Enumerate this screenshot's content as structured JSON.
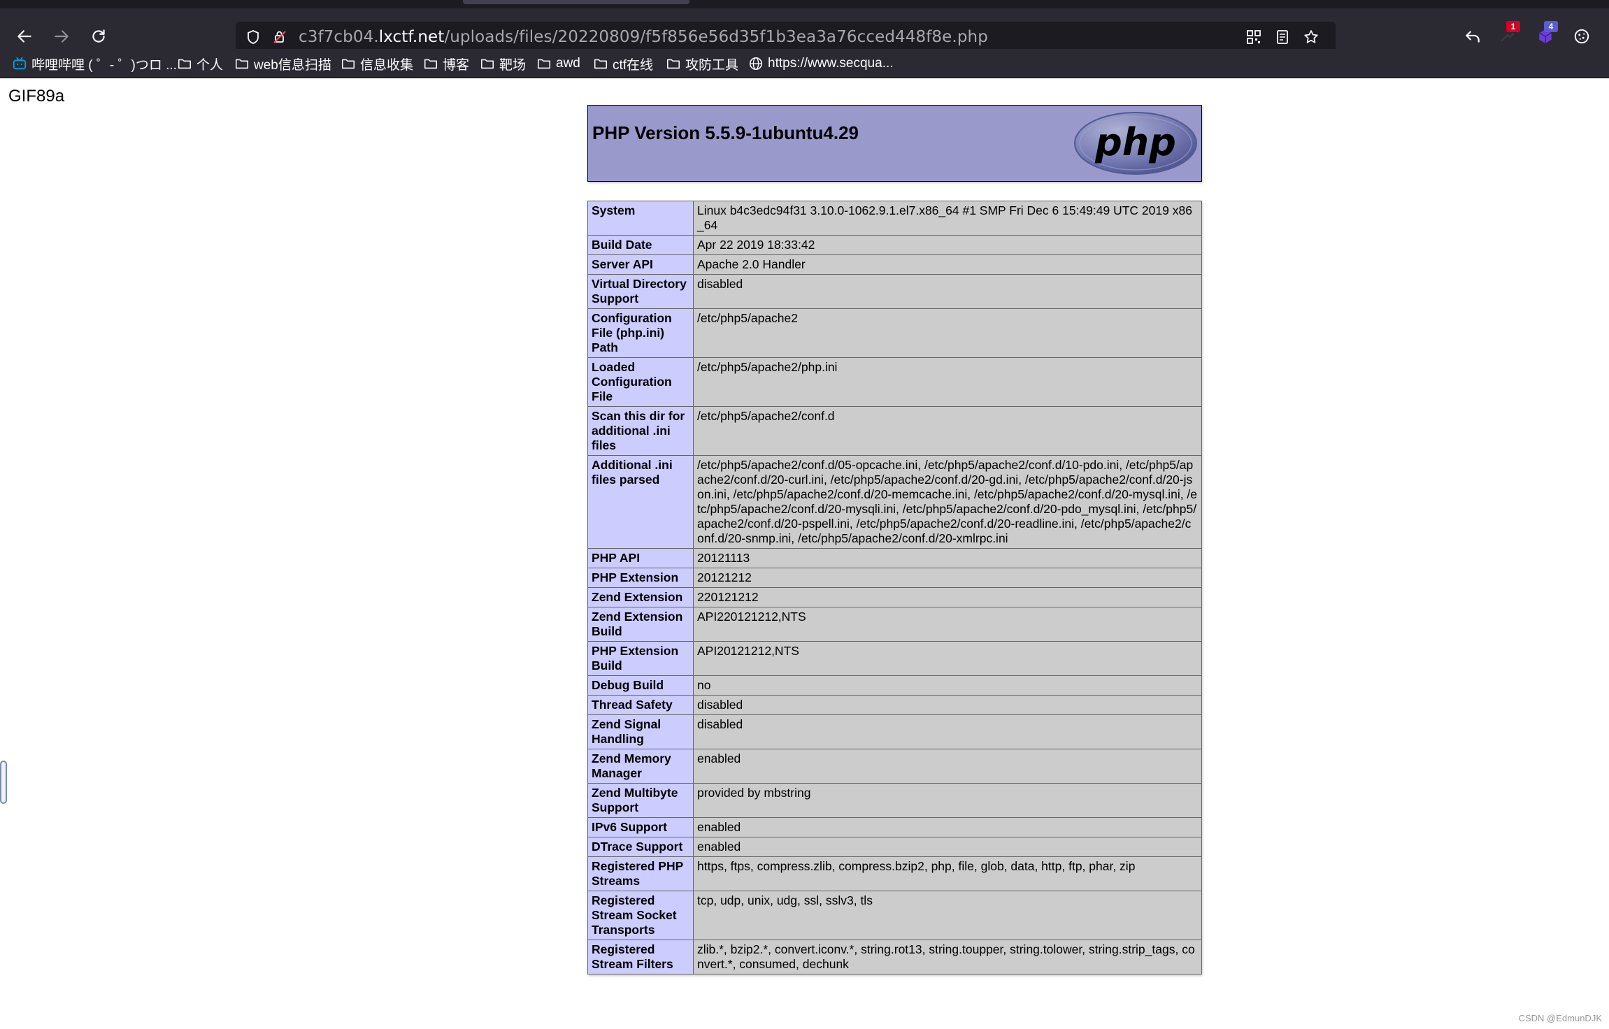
{
  "browser": {
    "url_prefix": "c3f7cb04.",
    "url_host": "lxctf.net",
    "url_path": "/uploads/files/20220809/f5f856e56d35f1b3ea3a76cced448f8e.php",
    "badges": {
      "ext1": "1",
      "ext2": "4"
    },
    "bookmarks": [
      {
        "label": "哔哩哔哩 ( ゜- ゜)つロ ...",
        "icon": "bilibili-icon"
      },
      {
        "label": "个人",
        "icon": "folder-icon"
      },
      {
        "label": "web信息扫描",
        "icon": "folder-icon"
      },
      {
        "label": "信息收集",
        "icon": "folder-icon"
      },
      {
        "label": "博客",
        "icon": "folder-icon"
      },
      {
        "label": "靶场",
        "icon": "folder-icon"
      },
      {
        "label": "awd",
        "icon": "folder-icon"
      },
      {
        "label": "ctf在线",
        "icon": "folder-icon"
      },
      {
        "label": "攻防工具",
        "icon": "folder-icon"
      },
      {
        "label": "https://www.secqua...",
        "icon": "globe-icon"
      }
    ]
  },
  "page": {
    "gif_header": "GIF89a",
    "php_title": "PHP Version 5.5.9-1ubuntu4.29",
    "php_logo": "php",
    "rows": [
      {
        "key": "System",
        "value": "Linux b4c3edc94f31 3.10.0-1062.9.1.el7.x86_64 #1 SMP Fri Dec 6 15:49:49 UTC 2019 x86_64"
      },
      {
        "key": "Build Date",
        "value": "Apr 22 2019 18:33:42"
      },
      {
        "key": "Server API",
        "value": "Apache 2.0 Handler"
      },
      {
        "key": "Virtual Directory Support",
        "value": "disabled"
      },
      {
        "key": "Configuration File (php.ini) Path",
        "value": "/etc/php5/apache2"
      },
      {
        "key": "Loaded Configuration File",
        "value": "/etc/php5/apache2/php.ini"
      },
      {
        "key": "Scan this dir for additional .ini files",
        "value": "/etc/php5/apache2/conf.d"
      },
      {
        "key": "Additional .ini files parsed",
        "value": "/etc/php5/apache2/conf.d/05-opcache.ini, /etc/php5/apache2/conf.d/10-pdo.ini, /etc/php5/apache2/conf.d/20-curl.ini, /etc/php5/apache2/conf.d/20-gd.ini, /etc/php5/apache2/conf.d/20-json.ini, /etc/php5/apache2/conf.d/20-memcache.ini, /etc/php5/apache2/conf.d/20-mysql.ini, /etc/php5/apache2/conf.d/20-mysqli.ini, /etc/php5/apache2/conf.d/20-pdo_mysql.ini, /etc/php5/apache2/conf.d/20-pspell.ini, /etc/php5/apache2/conf.d/20-readline.ini, /etc/php5/apache2/conf.d/20-snmp.ini, /etc/php5/apache2/conf.d/20-xmlrpc.ini"
      },
      {
        "key": "PHP API",
        "value": "20121113"
      },
      {
        "key": "PHP Extension",
        "value": "20121212"
      },
      {
        "key": "Zend Extension",
        "value": "220121212"
      },
      {
        "key": "Zend Extension Build",
        "value": "API220121212,NTS"
      },
      {
        "key": "PHP Extension Build",
        "value": "API20121212,NTS"
      },
      {
        "key": "Debug Build",
        "value": "no"
      },
      {
        "key": "Thread Safety",
        "value": "disabled"
      },
      {
        "key": "Zend Signal Handling",
        "value": "disabled"
      },
      {
        "key": "Zend Memory Manager",
        "value": "enabled"
      },
      {
        "key": "Zend Multibyte Support",
        "value": "provided by mbstring"
      },
      {
        "key": "IPv6 Support",
        "value": "enabled"
      },
      {
        "key": "DTrace Support",
        "value": "enabled"
      },
      {
        "key": "Registered PHP Streams",
        "value": "https, ftps, compress.zlib, compress.bzip2, php, file, glob, data, http, ftp, phar, zip"
      },
      {
        "key": "Registered Stream Socket Transports",
        "value": "tcp, udp, unix, udg, ssl, sslv3, tls"
      },
      {
        "key": "Registered Stream Filters",
        "value": "zlib.*, bzip2.*, convert.iconv.*, string.rot13, string.toupper, string.tolower, string.strip_tags, convert.*, consumed, dechunk"
      }
    ]
  },
  "watermark": "CSDN @EdmunDJK",
  "colors": {
    "php_header": "#9999cc",
    "key_cell": "#ccccff",
    "value_cell": "#cccccc",
    "chrome_dark": "#2b2a33"
  }
}
